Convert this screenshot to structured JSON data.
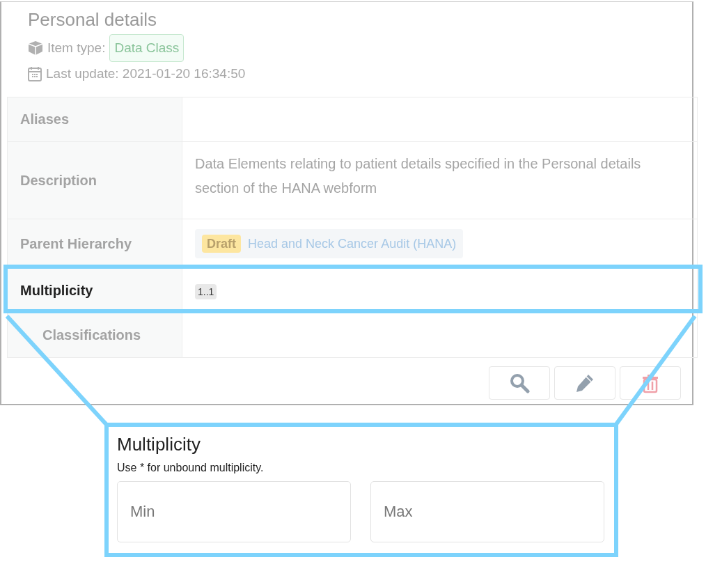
{
  "card": {
    "title": "Personal details",
    "item_type_label": "Item type:",
    "item_type": "Data Class",
    "last_update": "Last update: 2021-01-20 16:34:50"
  },
  "properties": [
    {
      "label": "Aliases",
      "kind": "empty",
      "highlighted": false
    },
    {
      "label": "Description",
      "kind": "text",
      "value": "Data Elements relating to patient details specified in the Personal details section of the HANA webform",
      "highlighted": false
    },
    {
      "label": "Parent Hierarchy",
      "kind": "path",
      "status": "Draft",
      "link": "Head and Neck Cancer Audit (HANA)",
      "highlighted": false
    },
    {
      "label": "Multiplicity",
      "kind": "tag",
      "value": "1..1",
      "highlighted": true
    },
    {
      "label": "Classifications",
      "kind": "empty",
      "highlighted": false
    }
  ],
  "actions": [
    {
      "kind": "search"
    },
    {
      "kind": "edit"
    },
    {
      "kind": "delete"
    }
  ],
  "callout": {
    "title": "Multiplicity",
    "hint": "Use * for unbound multiplicity.",
    "fields": [
      {
        "placeholder": "Min"
      },
      {
        "placeholder": "Max"
      }
    ]
  }
}
